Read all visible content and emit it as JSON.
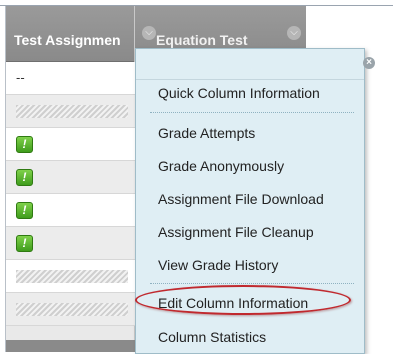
{
  "grid": {
    "columns": [
      {
        "label": "Test Assignmen"
      },
      {
        "label": "Equation Test"
      }
    ],
    "rows": [
      {
        "type": "text",
        "value": "--"
      },
      {
        "type": "hatch"
      },
      {
        "type": "needs-grading",
        "icon": "exclamation-icon",
        "glyph": "!"
      },
      {
        "type": "needs-grading",
        "icon": "exclamation-icon",
        "glyph": "!"
      },
      {
        "type": "needs-grading",
        "icon": "exclamation-icon",
        "glyph": "!"
      },
      {
        "type": "needs-grading",
        "icon": "exclamation-icon",
        "glyph": "!"
      },
      {
        "type": "hatch"
      },
      {
        "type": "hatch"
      }
    ]
  },
  "menu": {
    "close_icon": "close-icon",
    "close_glyph": "×",
    "items": [
      {
        "label": "Quick Column Information"
      },
      {
        "label": "Grade Attempts"
      },
      {
        "label": "Grade Anonymously"
      },
      {
        "label": "Assignment File Download"
      },
      {
        "label": "Assignment File Cleanup"
      },
      {
        "label": "View Grade History"
      },
      {
        "label": "Edit Column Information"
      },
      {
        "label": "Column Statistics"
      }
    ]
  },
  "colors": {
    "header": "#8f8f8f",
    "menu_bg": "#dfeef4",
    "highlight": "#c0292e",
    "warning": "#4caf2a"
  }
}
